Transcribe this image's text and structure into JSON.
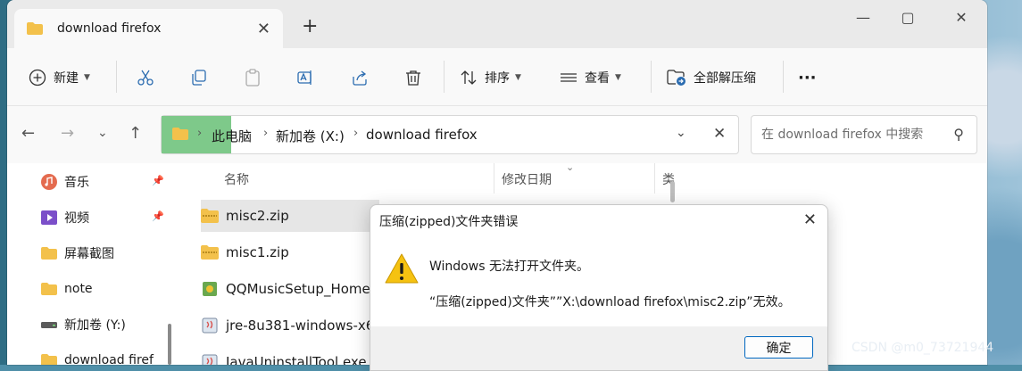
{
  "window": {
    "tab_title": "download firefox",
    "new_tab_symbol": "+",
    "controls": {
      "minimize": "—",
      "maximize": "▢",
      "close": "✕"
    }
  },
  "toolbar": {
    "new_label": "新建",
    "sort_label": "排序",
    "view_label": "查看",
    "extract_all_label": "全部解压缩",
    "more_label": "···"
  },
  "address": {
    "crumbs": [
      "此电脑",
      "新加卷 (X:)",
      "download firefox"
    ],
    "separator": "›"
  },
  "search": {
    "placeholder": "在 download firefox 中搜索"
  },
  "sidebar": {
    "items": [
      {
        "label": "音乐",
        "icon": "music-icon",
        "pinned": true
      },
      {
        "label": "视频",
        "icon": "video-icon",
        "pinned": true
      },
      {
        "label": "屏幕截图",
        "icon": "folder-icon",
        "pinned": false
      },
      {
        "label": "note",
        "icon": "folder-icon",
        "pinned": false
      },
      {
        "label": "新加卷 (Y:)",
        "icon": "drive-icon",
        "pinned": false
      },
      {
        "label": "download firef",
        "icon": "folder-icon",
        "pinned": false
      }
    ]
  },
  "files": {
    "columns": [
      "名称",
      "修改日期",
      "类"
    ],
    "rows": [
      {
        "name": "misc2.zip",
        "icon": "zip-folder-icon",
        "selected": true
      },
      {
        "name": "misc1.zip",
        "icon": "zip-folder-icon",
        "selected": false
      },
      {
        "name": "QQMusicSetup_Home",
        "icon": "installer-icon",
        "selected": false
      },
      {
        "name": "jre-8u381-windows-x6",
        "icon": "java-installer-icon",
        "selected": false
      },
      {
        "name": "JavaUninstallTool.exe",
        "icon": "java-installer-icon",
        "selected": false
      }
    ]
  },
  "dialog": {
    "title": "压缩(zipped)文件夹错误",
    "message1": "Windows 无法打开文件夹。",
    "message2": "“压缩(zipped)文件夹””X:\\download firefox\\misc2.zip”无效。",
    "ok_label": "确定"
  },
  "watermark": "CSDN @m0_73721944",
  "colors": {
    "accent": "#0067c0",
    "highlight": "#7ec98a",
    "warning": "#f5c211",
    "folder": "#f3c14b"
  }
}
